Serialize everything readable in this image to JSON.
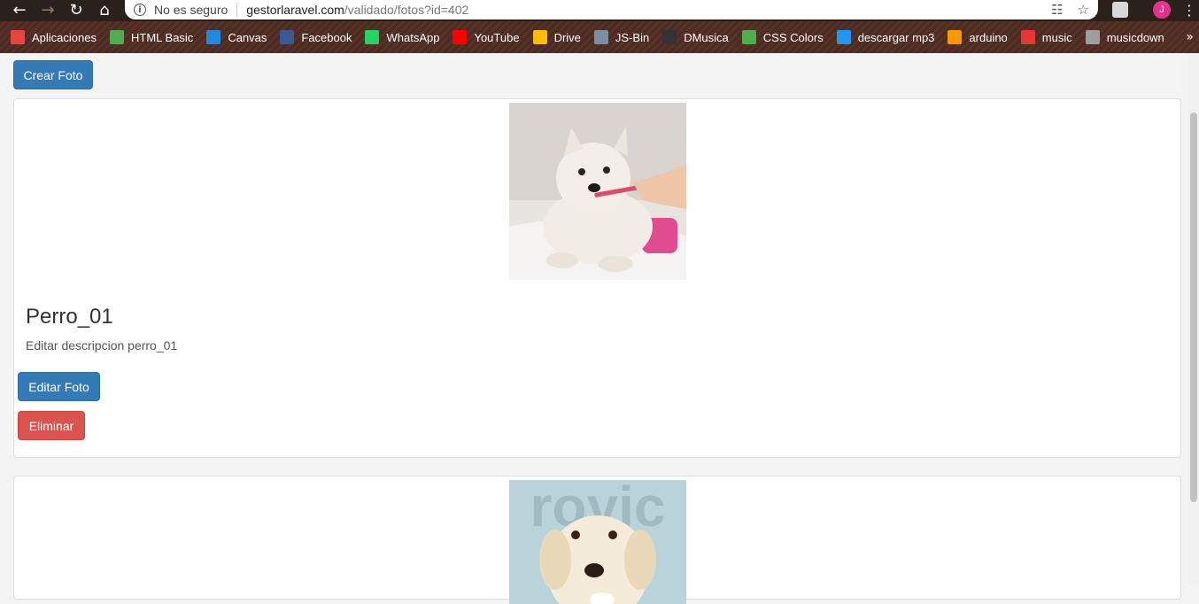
{
  "browser": {
    "security_label": "No es seguro",
    "url_host": "gestorlaravel.com",
    "url_path": "/validado/fotos?id=402",
    "profile_initial": "J"
  },
  "bookmarks": [
    {
      "label": "Aplicaciones",
      "icon": "apps-grid-icon",
      "color": "#e8453c"
    },
    {
      "label": "HTML Basic",
      "icon": "wave-icon",
      "color": "#4caf50"
    },
    {
      "label": "Canvas",
      "icon": "canvas-v-icon",
      "color": "#1e88e5"
    },
    {
      "label": "Facebook",
      "icon": "facebook-icon",
      "color": "#3b5998"
    },
    {
      "label": "WhatsApp",
      "icon": "whatsapp-icon",
      "color": "#25d366"
    },
    {
      "label": "YouTube",
      "icon": "youtube-icon",
      "color": "#ff0000"
    },
    {
      "label": "Drive",
      "icon": "drive-icon",
      "color": "#fbbc04"
    },
    {
      "label": "JS-Bin",
      "icon": "jsbin-icon",
      "color": "#7a8fa6"
    },
    {
      "label": "DMusica",
      "icon": "music-hand-icon",
      "color": "#333333"
    },
    {
      "label": "CSS Colors",
      "icon": "wave-icon",
      "color": "#4caf50"
    },
    {
      "label": "descargar mp3",
      "icon": "download-icon",
      "color": "#2196f3"
    },
    {
      "label": "arduino",
      "icon": "grid-color-icon",
      "color": "#ff9800"
    },
    {
      "label": "music",
      "icon": "music-note-icon",
      "color": "#e53935"
    },
    {
      "label": "musicdown",
      "icon": "disc-icon",
      "color": "#9e9e9e"
    }
  ],
  "page": {
    "create_button": "Crear Foto",
    "photos": [
      {
        "title": "Perro_01",
        "description": "Editar descripcion perro_01",
        "edit_label": "Editar Foto",
        "delete_label": "Eliminar"
      }
    ],
    "second_photo_watermark": "royic"
  }
}
